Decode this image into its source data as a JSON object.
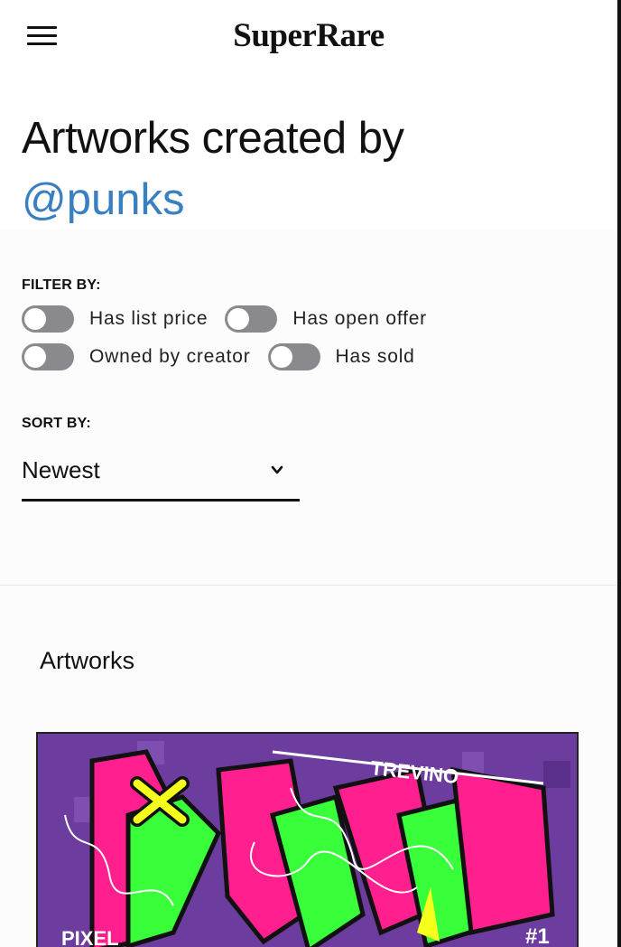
{
  "header": {
    "logo": "SuperRare",
    "menu_icon": "hamburger-menu-icon"
  },
  "hero": {
    "title": "Artworks created by",
    "handle": "@punks",
    "handle_color": "#3a7fc2"
  },
  "filters": {
    "label": "FILTER BY:",
    "options": [
      {
        "label": "Has list price",
        "enabled": false
      },
      {
        "label": "Has open offer",
        "enabled": false
      },
      {
        "label": "Owned by creator",
        "enabled": false
      },
      {
        "label": "Has sold",
        "enabled": false
      }
    ]
  },
  "sort": {
    "label": "SORT BY:",
    "selected": "Newest",
    "icon": "chevron-down-icon"
  },
  "artworks": {
    "heading": "Artworks",
    "first_card": {
      "text_top": "TREVINO",
      "text_left": "PIXEL",
      "text_right": "#1"
    }
  },
  "colors": {
    "toggle_off": "#8a8a8e",
    "accent": "#3a7fc2"
  }
}
